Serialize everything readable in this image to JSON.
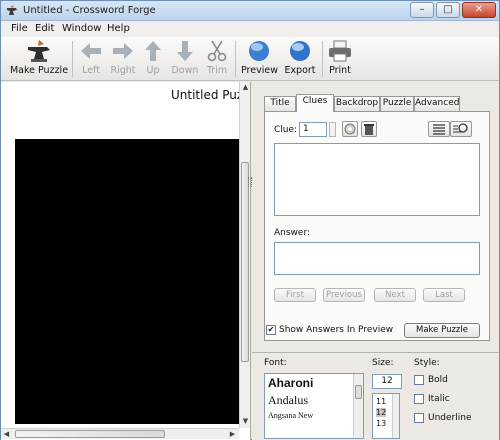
{
  "window": {
    "title": "Untitled - Crossword Forge",
    "minimize": "–",
    "maximize": "□",
    "close": "✕"
  },
  "menu": [
    "File",
    "Edit",
    "Window",
    "Help"
  ],
  "toolbar": {
    "make_puzzle": "Make Puzzle",
    "left": "Left",
    "right": "Right",
    "up": "Up",
    "down": "Down",
    "trim": "Trim",
    "preview": "Preview",
    "export": "Export",
    "print": "Print"
  },
  "editor": {
    "puzzle_title": "Untitled Puzzle"
  },
  "tabs": [
    "Title",
    "Clues",
    "Backdrop",
    "Puzzle",
    "Advanced"
  ],
  "active_tab": "Clues",
  "clues": {
    "clue_label": "Clue:",
    "clue_number": "1",
    "answer_label": "Answer:",
    "first": "First",
    "previous": "Previous",
    "next": "Next",
    "last": "Last",
    "show_answers": "Show Answers In Preview",
    "show_answers_checked": true,
    "make_puzzle": "Make Puzzle"
  },
  "font_panel": {
    "font_label": "Font:",
    "size_label": "Size:",
    "style_label": "Style:",
    "fonts": [
      "Aharoni",
      "Andalus",
      "Angsana New"
    ],
    "size_value": "12",
    "sizes": [
      "11",
      "12",
      "13"
    ],
    "selected_size": "12",
    "bold": "Bold",
    "italic": "Italic",
    "underline": "Underline"
  }
}
